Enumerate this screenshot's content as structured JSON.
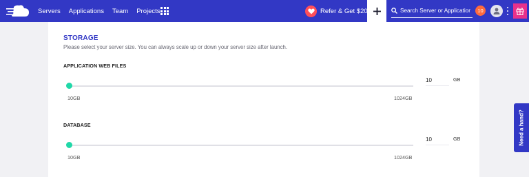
{
  "nav": {
    "links": [
      "Servers",
      "Applications",
      "Team",
      "Projects"
    ],
    "refer_label": "Refer & Get $20",
    "search_placeholder": "Search Server or Application",
    "notification_count": "10"
  },
  "storage": {
    "title": "STORAGE",
    "description": "Please select your server size. You can always scale up or down your server size after launch.",
    "app_files": {
      "label": "APPLICATION WEB FILES",
      "min": "10GB",
      "max": "1024GB",
      "value": "10",
      "unit": "GB",
      "position": 0
    },
    "database": {
      "label": "DATABASE",
      "min": "10GB",
      "max": "1024GB",
      "value": "10",
      "unit": "GB",
      "position": 0
    }
  },
  "help": {
    "label": "Need a hand?"
  },
  "colors": {
    "topbar": "#3238c5",
    "accent": "#20d8a8",
    "heart": "#ff4f5a",
    "notification": "#ff6a3d",
    "gift": "#e8318b"
  },
  "icons": [
    "cloud-logo-icon",
    "apps-grid-icon",
    "heart-icon",
    "plus-icon",
    "search-icon",
    "user-icon",
    "more-vertical-icon",
    "gift-icon"
  ]
}
